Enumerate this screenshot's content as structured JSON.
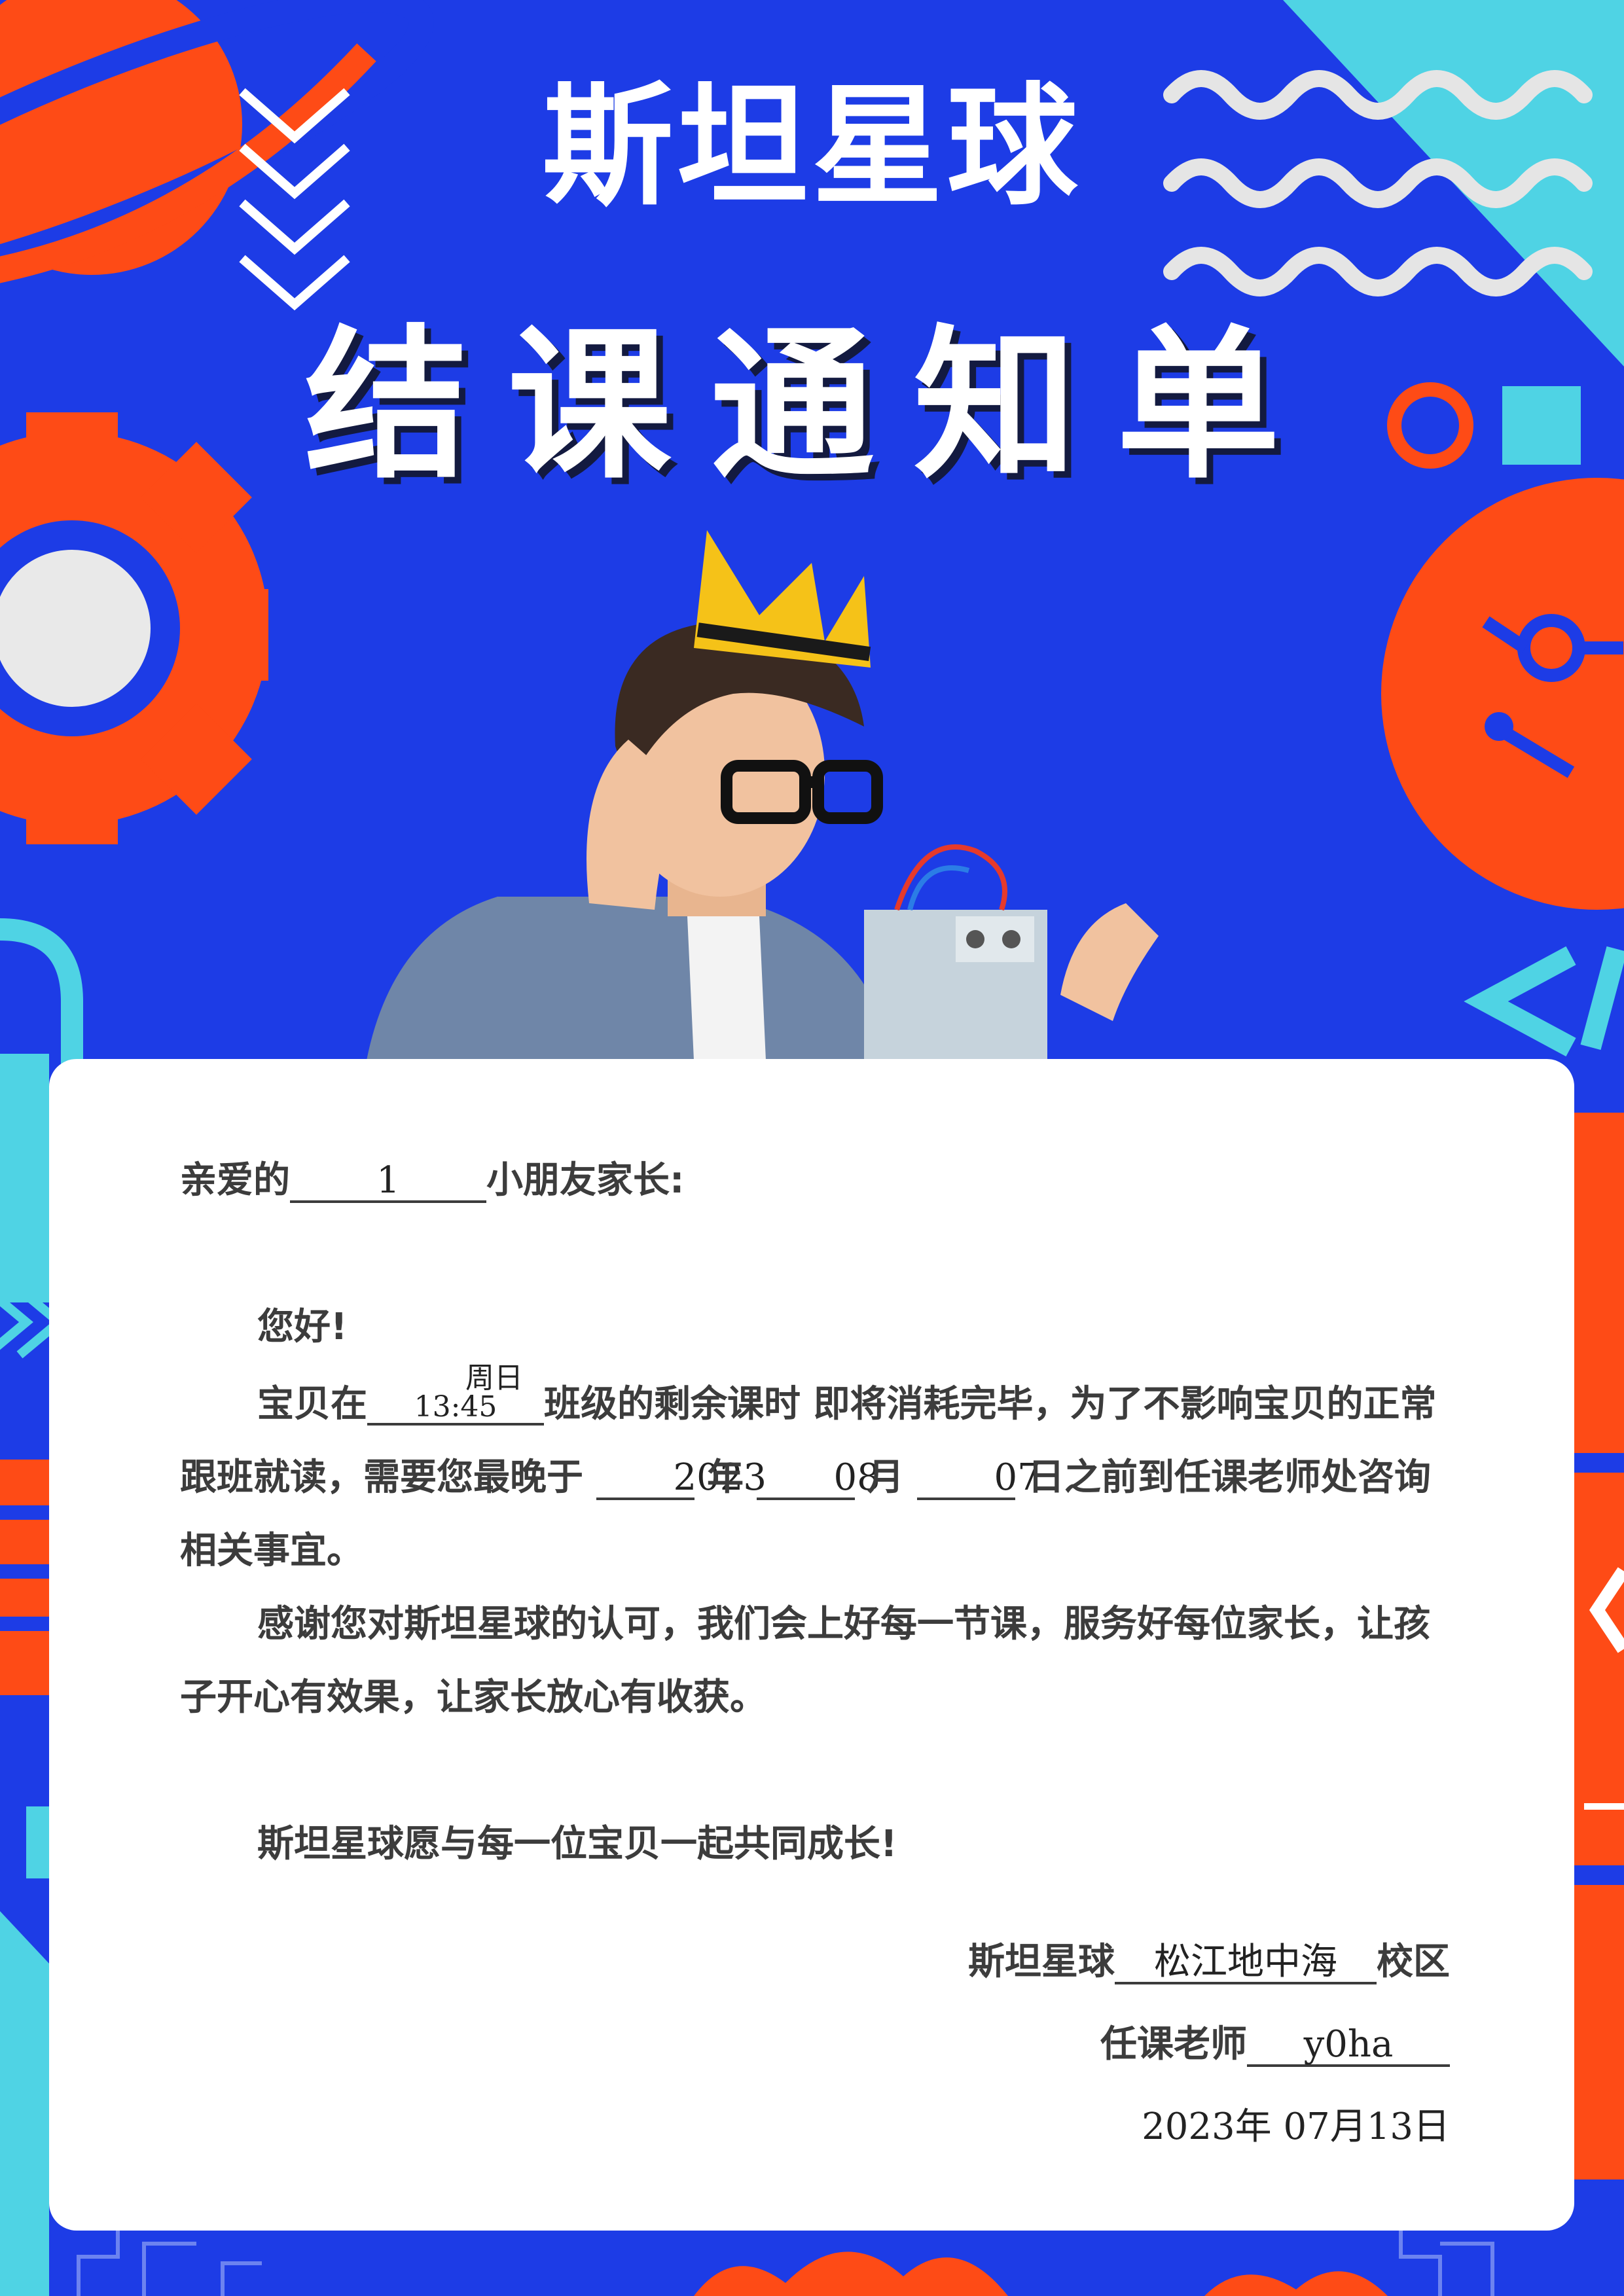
{
  "header": {
    "brand": "斯坦星球",
    "title": "结课通知单"
  },
  "illustration": {
    "icons": [
      "planet-icon",
      "chevron-down-icon",
      "wave-lines-icon",
      "gear-icon",
      "ring-icon",
      "square-icon",
      "crown-icon",
      "code-brackets-icon",
      "robot-kit-icon"
    ],
    "colors": {
      "blue": "#1d3ce6",
      "orange": "#fe4b16",
      "cyan": "#4fd3e4",
      "crown": "#f5c218",
      "card": "#ffffff"
    }
  },
  "letter": {
    "salutation_prefix": "亲爱的",
    "child_name": "1",
    "salutation_suffix": "小朋友家长:",
    "greeting": "您好!",
    "p1_prefix": "宝贝在",
    "class_time": "周日 13:45",
    "p1_middle": "班级的剩余课时 即将消耗完毕，为了不影响宝贝的正常跟班就读，需要您最晚于",
    "deadline_year": "2023",
    "year_label": "年",
    "deadline_month": "08",
    "month_label": "月",
    "deadline_day": "07",
    "p1_suffix": "日之前到任课老师处咨询相关事宜。",
    "p2": "感谢您对斯坦星球的认可，我们会上好每一节课，服务好每位家长，让孩子开心有效果，让家长放心有收获。",
    "p3": "斯坦星球愿与每一位宝贝一起共同成长!"
  },
  "signature": {
    "brand": "斯坦星球",
    "campus": "松江地中海",
    "campus_suffix": "校区",
    "teacher_label": "任课老师",
    "teacher_name": "y0ha",
    "date": "2023年 07月13日"
  }
}
